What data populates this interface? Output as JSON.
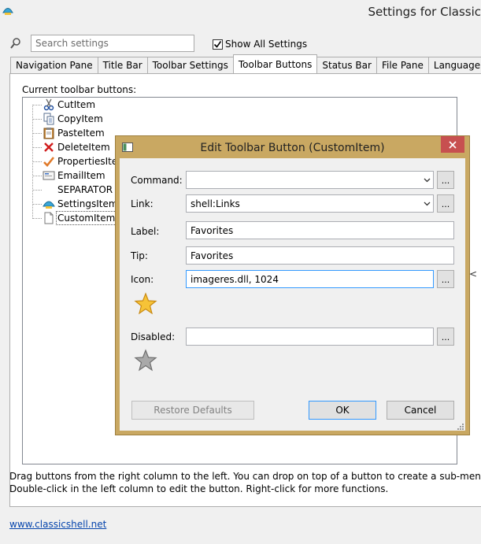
{
  "window": {
    "title": "Settings for Classic"
  },
  "search": {
    "placeholder": "Search settings"
  },
  "show_all": {
    "label": "Show All Settings",
    "checked": true
  },
  "tabs": [
    {
      "label": "Navigation Pane",
      "active": false
    },
    {
      "label": "Title Bar",
      "active": false
    },
    {
      "label": "Toolbar Settings",
      "active": false
    },
    {
      "label": "Toolbar Buttons",
      "active": true
    },
    {
      "label": "Status Bar",
      "active": false
    },
    {
      "label": "File Pane",
      "active": false
    },
    {
      "label": "Language",
      "active": false
    }
  ],
  "tree": {
    "label": "Current toolbar buttons:",
    "items": [
      {
        "label": "CutItem",
        "icon": "scissors-icon"
      },
      {
        "label": "CopyItem",
        "icon": "copy-icon"
      },
      {
        "label": "PasteItem",
        "icon": "clipboard-icon"
      },
      {
        "label": "DeleteItem",
        "icon": "red-x-icon"
      },
      {
        "label": "PropertiesItem",
        "icon": "checkmark-icon"
      },
      {
        "label": "EmailItem",
        "icon": "envelope-icon"
      },
      {
        "label": "SEPARATOR",
        "icon": ""
      },
      {
        "label": "SettingsItem",
        "icon": "shell-icon"
      },
      {
        "label": "CustomItem",
        "icon": "blank-document-icon",
        "selected": true
      }
    ]
  },
  "hints": {
    "line1": "Drag buttons from the right column to the left. You can drop on top of a button to create a sub-menu.",
    "line2": "Double-click in the left column to edit the button. Right-click for more functions."
  },
  "footer": {
    "link": "www.classicshell.net"
  },
  "dialog": {
    "title": "Edit Toolbar Button (CustomItem)",
    "command": {
      "label": "Command:",
      "value": ""
    },
    "link": {
      "label": "Link:",
      "value": "shell:Links"
    },
    "label_field": {
      "label": "Label:",
      "value": "Favorites"
    },
    "tip": {
      "label": "Tip:",
      "value": "Favorites"
    },
    "icon": {
      "label": "Icon:",
      "value": "imageres.dll, 1024",
      "preview": "gold-star-icon"
    },
    "disabled": {
      "label": "Disabled:",
      "value": "",
      "preview": "gray-star-icon"
    },
    "browse_label": "...",
    "buttons": {
      "restore": "Restore Defaults",
      "ok": "OK",
      "cancel": "Cancel"
    }
  },
  "colors": {
    "dialog_frame": "#c9a862",
    "close_button": "#c75050",
    "link": "#0645ad",
    "focus": "#3399ff"
  }
}
